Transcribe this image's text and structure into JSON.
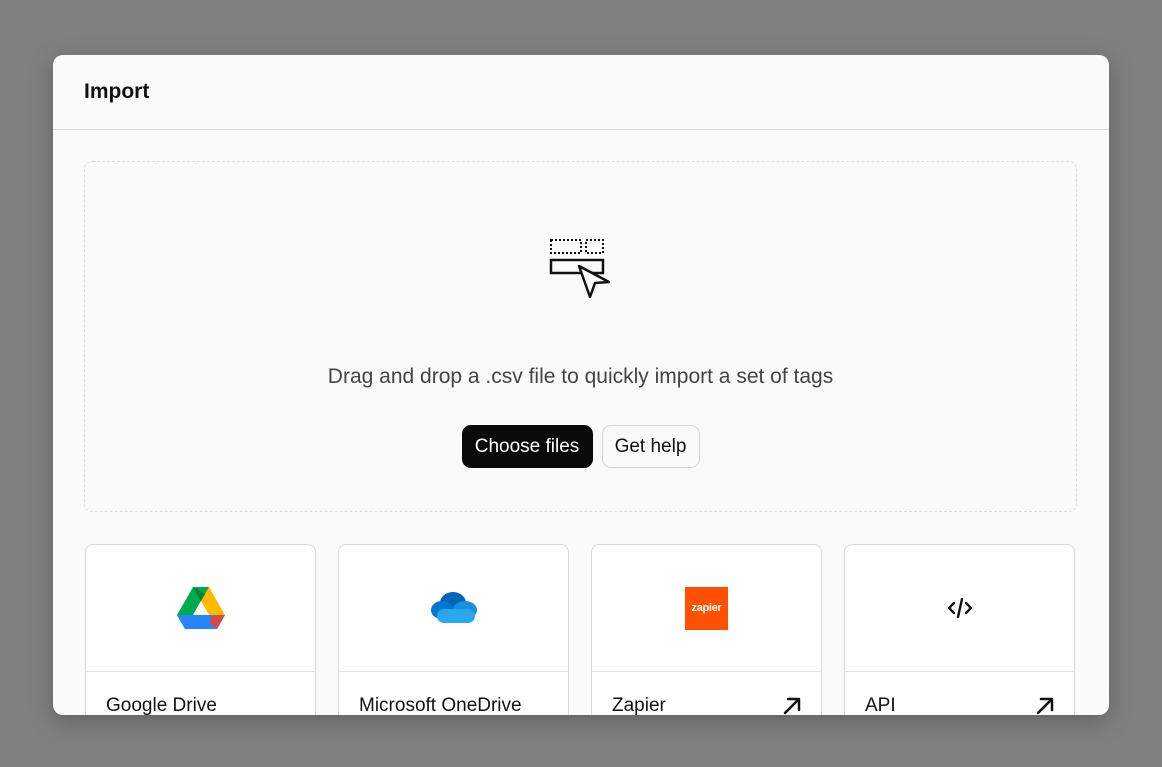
{
  "modal": {
    "title": "Import"
  },
  "dropzone": {
    "icon": "drag-drop-cursor-icon",
    "message": "Drag and drop a .csv file to quickly import a set of tags",
    "choose_files_label": "Choose files",
    "get_help_label": "Get help"
  },
  "sources": [
    {
      "label": "Google Drive",
      "icon": "google-drive-icon",
      "external": false
    },
    {
      "label": "Microsoft OneDrive",
      "icon": "onedrive-icon",
      "external": false
    },
    {
      "label": "Zapier",
      "icon": "zapier-icon",
      "logo_text": "zapier",
      "external": true
    },
    {
      "label": "API",
      "icon": "code-icon",
      "external": true
    }
  ],
  "colors": {
    "backdrop": "#808080",
    "modal_bg": "#fafafa",
    "primary_button": "#0a0a0a",
    "zapier_orange": "#ff4f00"
  }
}
